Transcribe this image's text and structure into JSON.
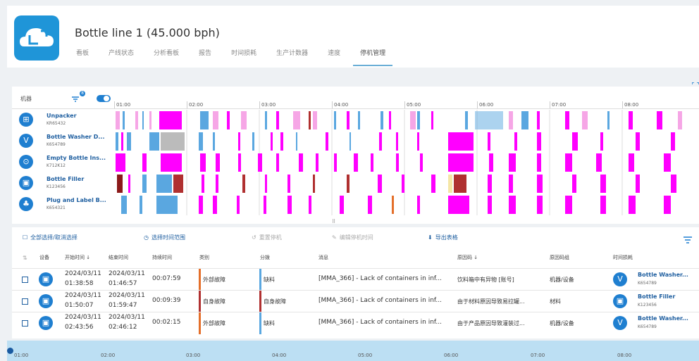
{
  "header": {
    "title": "Bottle line 1 (45.000 bph)",
    "tabs": [
      "看板",
      "产线状态",
      "分析看板",
      "报告",
      "时间损耗",
      "生产计数器",
      "速度",
      "停机管理"
    ],
    "active_tab": "停机管理"
  },
  "gantt": {
    "machine_column_label": "机器",
    "filter_count": "8",
    "time_ticks": [
      "01:00",
      "02:00",
      "03:00",
      "04:00",
      "05:00",
      "06:00",
      "07:00",
      "08:00"
    ],
    "machines": [
      {
        "name": "Unpacker",
        "code": "KR65432",
        "icon": "⊞"
      },
      {
        "name": "Bottle Washer D...",
        "code": "K654789",
        "icon": "V"
      },
      {
        "name": "Empty Bottle Ins...",
        "code": "K712K12",
        "icon": "⊙"
      },
      {
        "name": "Bottle Filler",
        "code": "K123456",
        "icon": "▣"
      },
      {
        "name": "Plug and Label B...",
        "code": "K654321",
        "icon": "♣"
      }
    ],
    "colors": {
      "magenta": "#ff00ff",
      "light_blue": "#5aa7e0",
      "dark_red": "#b03030",
      "gray": "#bbbbbb",
      "pink": "#f6a6e6",
      "orange": "#e46f2a",
      "yellow": "#f5e6a6",
      "brown": "#8b1a1a"
    }
  },
  "toolbar": {
    "select_all": "全部选择/取消选择",
    "select_time_range": "选择时间范围",
    "reset_downtime": "重置停机",
    "edit_downtime": "编辑停机时间",
    "export_table": "导出表格"
  },
  "table": {
    "headers": [
      "设备",
      "开始时间 ↓",
      "结束时间",
      "持续时间",
      "类别",
      "分拨",
      "消息",
      "原因码 ↓",
      "原因码组",
      "时间损耗"
    ],
    "rows": [
      {
        "start": [
          "2024/03/11",
          "01:38:58"
        ],
        "end": [
          "2024/03/11",
          "01:46:57"
        ],
        "duration": "00:07:59",
        "category": "外部故障",
        "category_color": "#e46f2a",
        "dispatch": "缺料",
        "dispatch_color": "#5aa7e0",
        "message": "[MMA_366] - Lack of containers in inf...",
        "reason": "饮料箱中有异物 [账号]",
        "reason_group": "机器/设备",
        "machine": {
          "name": "Bottle Washer...",
          "code": "K654789",
          "icon": "V"
        }
      },
      {
        "start": [
          "2024/03/11",
          "01:50:07"
        ],
        "end": [
          "2024/03/11",
          "01:59:47"
        ],
        "duration": "00:09:39",
        "category": "自身故障",
        "category_color": "#b03030",
        "dispatch": "自身故障",
        "dispatch_color": "#b03030",
        "message": "[MMA_366] - Lack of containers in inf...",
        "reason": "由于材料原因导致易拉罐...",
        "reason_group": "材料",
        "machine": {
          "name": "Bottle Filler",
          "code": "K123456",
          "icon": "▣"
        }
      },
      {
        "start": [
          "2024/03/11",
          "02:43:56"
        ],
        "end": [
          "2024/03/11",
          "02:46:12"
        ],
        "duration": "00:02:15",
        "category": "外部故障",
        "category_color": "#e46f2a",
        "dispatch": "缺料",
        "dispatch_color": "#5aa7e0",
        "message": "[MMA_366] - Lack of containers in inf...",
        "reason": "由于产品原因导致灌装过...",
        "reason_group": "机器/设备",
        "machine": {
          "name": "Bottle Washer...",
          "code": "K654789",
          "icon": "V"
        }
      }
    ]
  },
  "overview": {
    "ticks": [
      "01:00",
      "02:00",
      "03:00",
      "04:00",
      "05:00",
      "06:00",
      "07:00",
      "08:00"
    ]
  }
}
